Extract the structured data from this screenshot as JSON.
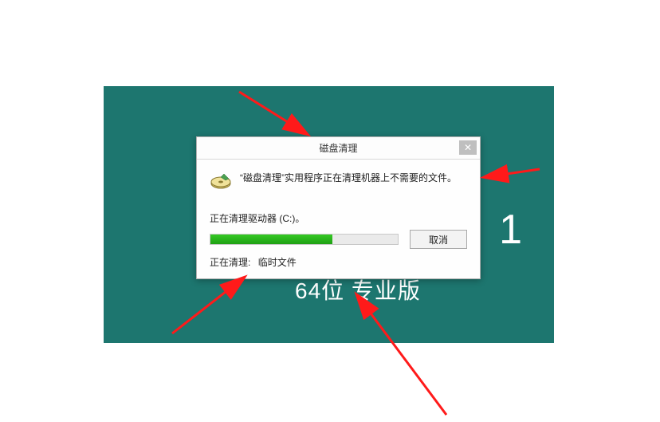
{
  "desktop": {
    "bg_big": "1",
    "bg_bottom": "64位   专业版"
  },
  "dialog": {
    "title": "磁盘清理",
    "close": "✕",
    "message": "“磁盘清理”实用程序正在清理机器上不需要的文件。",
    "progress_label": "正在清理驱动器 (C:)。",
    "progress_percent": 65,
    "cancel": "取消",
    "status_key": "正在清理:",
    "status_val": "临时文件"
  }
}
